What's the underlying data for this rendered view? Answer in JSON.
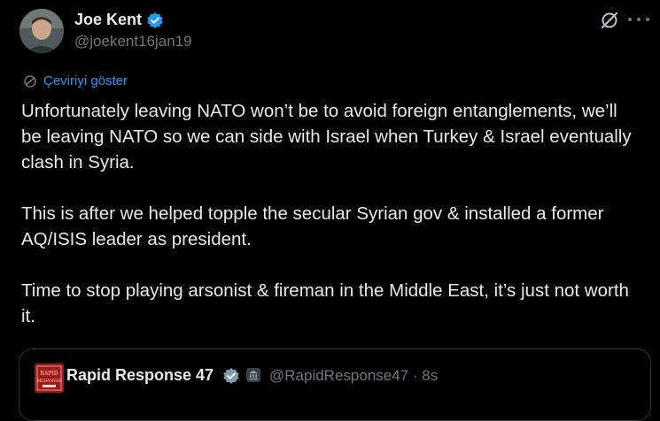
{
  "author": {
    "name": "Joe Kent",
    "handle": "@joekent16jan19"
  },
  "translate_label": "Çeviriyi göster",
  "tweet": {
    "paragraphs": [
      "Unfortunately leaving NATO won’t be to avoid foreign entanglements, we’ll be leaving NATO so we can side with Israel when Turkey & Israel eventually clash in Syria.",
      "This is after we helped topple the secular Syrian gov & installed a former AQ/ISIS leader as president.",
      "Time to stop playing arsonist & fireman in the Middle East, it’s just not worth it."
    ]
  },
  "quote": {
    "name": "Rapid Response 47",
    "handle": "@RapidResponse47",
    "time": "· 8s",
    "avatar_text": "RAPID RESPONSE"
  },
  "colors": {
    "background": "#000000",
    "text": "#e7e9ea",
    "muted": "#71767b",
    "accent": "#1d9bf0",
    "verified_blue": "#1d9bf0",
    "verified_gray": "#829aab"
  },
  "icons": {
    "verified": "verified-badge-icon",
    "grok": "grok-icon",
    "more": "more-icon",
    "translate": "translate-icon",
    "gov": "government-badge-icon"
  }
}
